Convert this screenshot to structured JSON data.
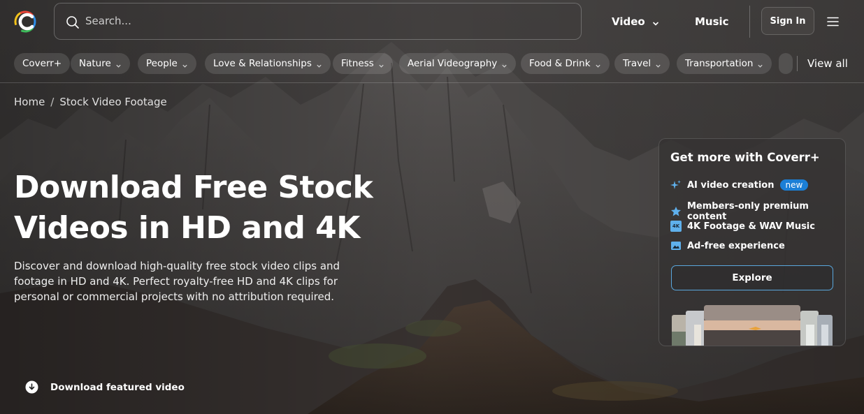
{
  "header": {
    "search_placeholder": "Search...",
    "nav_video": "Video",
    "nav_music": "Music",
    "sign_in": "Sign In"
  },
  "categories": [
    {
      "label": "Coverr+",
      "has_dropdown": false
    },
    {
      "label": "Nature",
      "has_dropdown": true
    },
    {
      "label": "People",
      "has_dropdown": true
    },
    {
      "label": "Love & Relationships",
      "has_dropdown": true
    },
    {
      "label": "Fitness",
      "has_dropdown": true
    },
    {
      "label": "Aerial Videography",
      "has_dropdown": true
    },
    {
      "label": "Food & Drink",
      "has_dropdown": true
    },
    {
      "label": "Travel",
      "has_dropdown": true
    },
    {
      "label": "Transportation",
      "has_dropdown": true
    }
  ],
  "view_all": "View all",
  "breadcrumb": {
    "home": "Home",
    "separator": "/",
    "current": "Stock Video Footage"
  },
  "hero": {
    "title_line1": "Download Free Stock",
    "title_line2": "Videos in HD and 4K",
    "description": "Discover and download high-quality free stock video clips and footage in HD and 4K. Perfect royalty-free HD and 4K clips for personal or commercial projects with no attribution required.",
    "download_featured": "Download featured video"
  },
  "panel": {
    "title": "Get more with Coverr+",
    "features": [
      {
        "icon": "sparkles-icon",
        "label": "AI video creation",
        "badge": "new"
      },
      {
        "icon": "star-badge-icon",
        "label": "Members-only premium content"
      },
      {
        "icon": "4k-icon",
        "label": "4K Footage & WAV Music",
        "icon_text": "4K"
      },
      {
        "icon": "image-icon",
        "label": "Ad-free experience"
      }
    ],
    "explore": "Explore"
  },
  "colors": {
    "accent_blue": "#1b7fd6",
    "explore_border": "#5aa7dd",
    "panel_bg": "#343232"
  }
}
